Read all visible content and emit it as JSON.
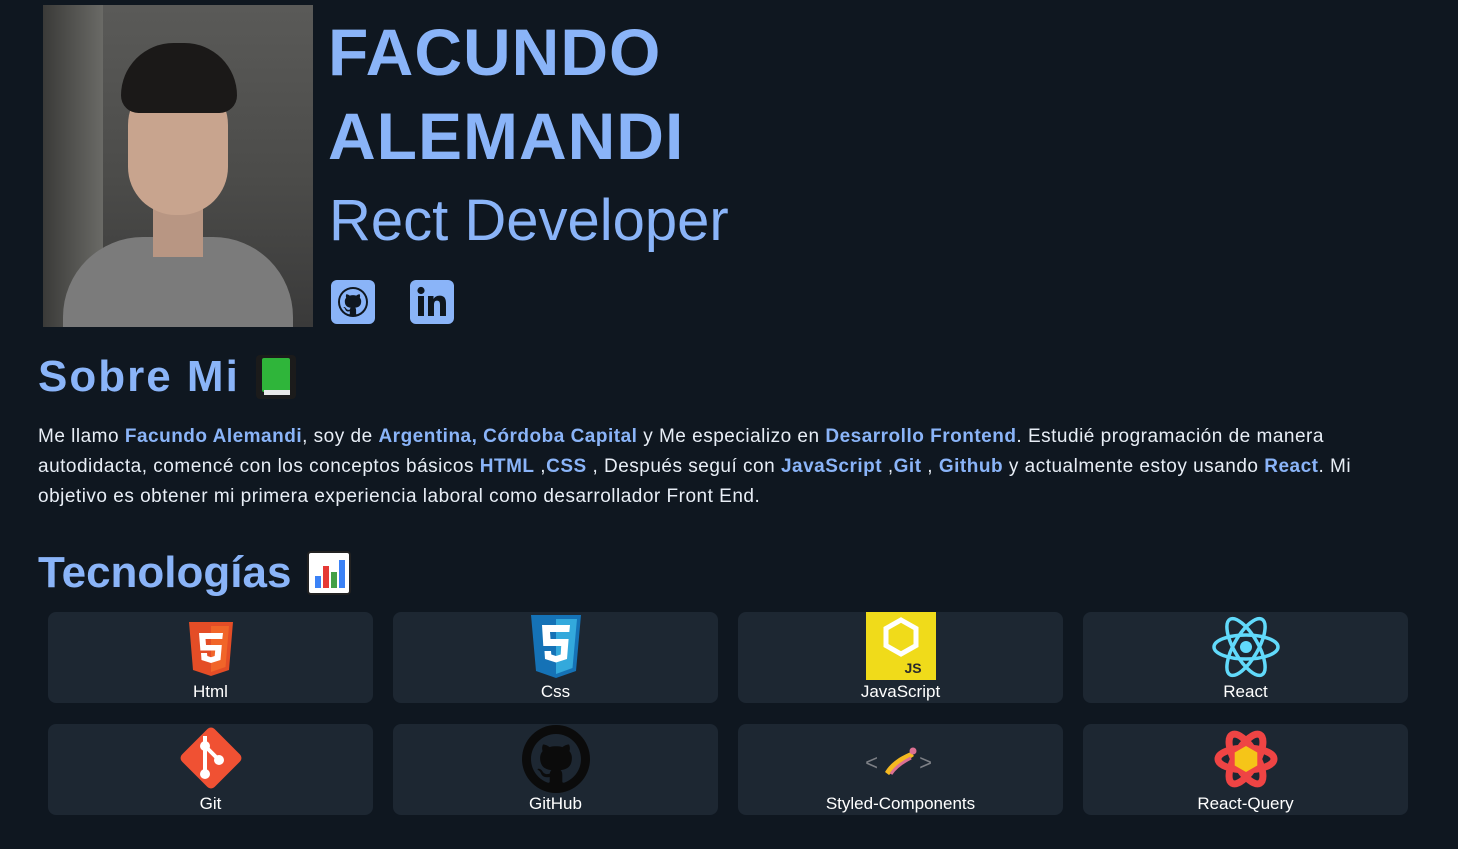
{
  "header": {
    "name_line1": "FACUNDO",
    "name_line2": "ALEMANDI",
    "role": "Rect Developer",
    "social": [
      "github-icon",
      "linkedin-icon"
    ]
  },
  "about": {
    "title": "Sobre Mi",
    "emoji": "green-book",
    "t1": "Me llamo ",
    "name": "Facundo Alemandi",
    "t2": ", soy de ",
    "location": "Argentina, Córdoba Capital",
    "t3": " y Me especializo en ",
    "specialty": "Desarrollo Frontend",
    "t4": ". Estudié programación de manera autodidacta, comencé con los conceptos básicos ",
    "html": "HTML",
    "t5": " ,",
    "css": "CSS",
    "t6": " , Después seguí con ",
    "js": "JavaScript",
    "t7": " ,",
    "git": "Git",
    "t8": " , ",
    "github": "Github",
    "t9": " y actualmente estoy usando ",
    "react": "React",
    "t10": ". Mi objetivo es obtener mi primera experiencia laboral como desarrollador Front End."
  },
  "tech": {
    "title": "Tecnologías",
    "emoji": "bar-chart",
    "items": [
      {
        "label": "Html",
        "icon": "html5-icon"
      },
      {
        "label": "Css",
        "icon": "css3-icon"
      },
      {
        "label": "JavaScript",
        "icon": "javascript-icon"
      },
      {
        "label": "React",
        "icon": "react-icon"
      },
      {
        "label": "Git",
        "icon": "git-icon"
      },
      {
        "label": "GitHub",
        "icon": "github-icon"
      },
      {
        "label": "Styled-Components",
        "icon": "styled-components-icon"
      },
      {
        "label": "React-Query",
        "icon": "react-query-icon"
      }
    ]
  },
  "colors": {
    "background": "#0f1720",
    "accent": "#8ab4f8",
    "card": "#1d2732"
  }
}
